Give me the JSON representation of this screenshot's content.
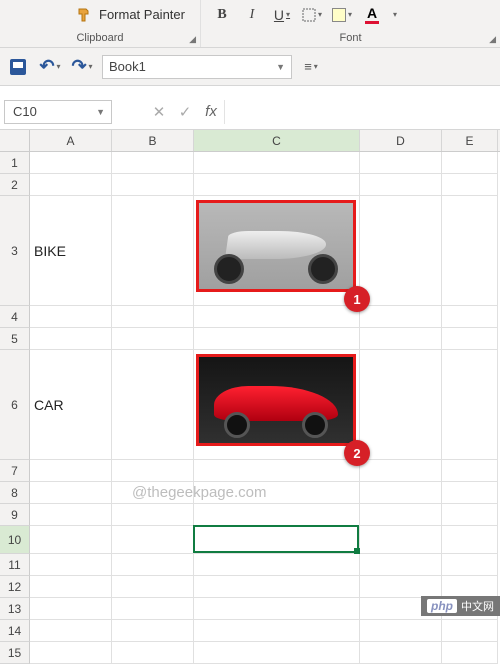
{
  "ribbon": {
    "format_painter_label": "Format Painter",
    "clipboard_group": "Clipboard",
    "font_group": "Font",
    "bold": "B",
    "italic": "I",
    "underline": "U",
    "fontcolor_glyph": "A"
  },
  "qat": {
    "doc_name": "Book1",
    "save_tip": "Save",
    "undo_tip": "Undo",
    "redo_tip": "Redo"
  },
  "namebox": {
    "value": "C10"
  },
  "fx": {
    "cancel": "✕",
    "enter": "✓",
    "fx": "fx"
  },
  "columns": [
    "A",
    "B",
    "C",
    "D",
    "E"
  ],
  "rows": [
    "1",
    "2",
    "3",
    "4",
    "5",
    "6",
    "7",
    "8",
    "9",
    "10",
    "11",
    "12",
    "13",
    "14",
    "15"
  ],
  "cells": {
    "A3": "BIKE",
    "A6": "CAR"
  },
  "active_cell": "C10",
  "images": [
    {
      "name": "bike-image",
      "badge": "1"
    },
    {
      "name": "car-image",
      "badge": "2"
    }
  ],
  "watermark": "@thegeekpage.com",
  "footer_badge": {
    "left": "php",
    "right": "中文网"
  }
}
